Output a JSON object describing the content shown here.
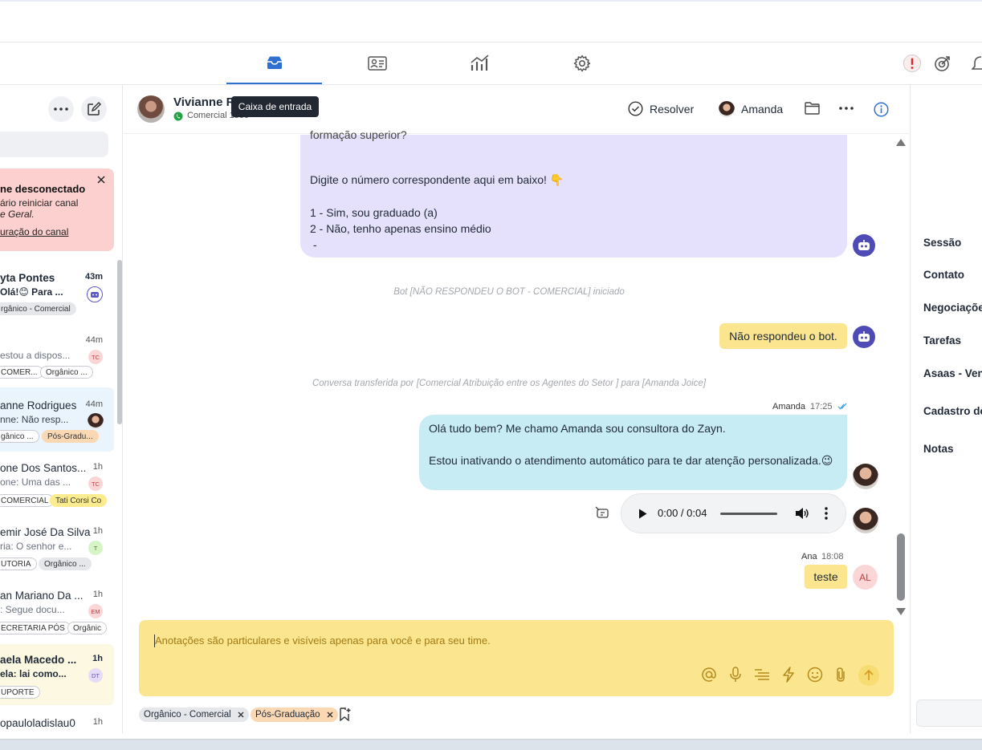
{
  "nav": {
    "tabs": [
      "inbox-icon",
      "contacts-icon",
      "reports-icon",
      "settings-icon"
    ],
    "tooltip": "Caixa de entrada"
  },
  "sidebar": {
    "alert": {
      "title": "ne desconectado",
      "line1": "ário reiniciar canal",
      "line2": "e Geral.",
      "link": "uração do canal"
    },
    "conversations": [
      {
        "name": "yta Pontes",
        "time": "43m",
        "preview": "Olá!😊 Para ...",
        "unread": true,
        "tags": [
          {
            "label": "rgânico - Comercial",
            "style": "grey"
          }
        ]
      },
      {
        "name": "",
        "time": "44m",
        "preview": "estou a dispos...",
        "avatar": "TC",
        "tags": [
          {
            "label": "COMER...",
            "style": "outline"
          },
          {
            "label": "Orgânico ...",
            "style": "outline"
          }
        ]
      },
      {
        "name": "anne Rodrigues",
        "time": "44m",
        "preview": "nne: Não resp...",
        "selected": true,
        "tags": [
          {
            "label": "gânico ...",
            "style": "outline"
          },
          {
            "label": "Pós-Gradu...",
            "style": "orange"
          }
        ]
      },
      {
        "name": "one Dos Santos...",
        "time": "1h",
        "preview": "one: Uma das ...",
        "avatar": "TC",
        "tags": [
          {
            "label": "COMERCIAL",
            "style": "outline"
          },
          {
            "label": "Tati Corsi Co",
            "style": "yellow"
          }
        ]
      },
      {
        "name": "emir José Da Silva",
        "time": "1h",
        "preview": "ria: O senhor e...",
        "avatar": "T",
        "tags": [
          {
            "label": "UTORIA",
            "style": "outline"
          },
          {
            "label": "Orgânico ...",
            "style": "grey"
          }
        ]
      },
      {
        "name": "an Mariano Da ...",
        "time": "1h",
        "preview": ": Segue docu...",
        "avatar": "EM",
        "tags": [
          {
            "label": "ECRETARIA PÓS",
            "style": "outline"
          },
          {
            "label": "Orgânic",
            "style": "outline"
          }
        ]
      },
      {
        "name": "aela Macedo ...",
        "time": "1h",
        "preview": "ela: lai como...",
        "avatar": "DT",
        "unread": true,
        "tags": [
          {
            "label": "UPORTE",
            "style": "outline"
          }
        ]
      },
      {
        "name": "opauloladislau0",
        "time": "1h",
        "preview": "",
        "tags": []
      }
    ]
  },
  "chat": {
    "contact_name": "Vivianne R",
    "contact_sub": "Comercial 1330",
    "resolve_label": "Resolver",
    "agent_name": "Amanda",
    "messages": {
      "bot_cut": "formação superior?",
      "bot_line1": "Digite o número correspondente aqui em baixo! 👇",
      "bot_line2": "1 - Sim, sou graduado (a)",
      "bot_line3": "2 - Não, tenho apenas ensino médio",
      "bot_line4": " -",
      "sys1": "Bot [NÃO RESPONDEU O BOT - COMERCIAL] iniciado",
      "bot_reply": "Não respondeu o bot.",
      "sys2": "Conversa transferida por [Comercial Atribuição entre os Agentes do Setor ] para [Amanda Joice]",
      "agent_sender": "Amanda",
      "agent_time": "17:25",
      "agent_line1": "Olá tudo bem? Me chamo Amanda sou consultora do Zayn.",
      "agent_line2": "Estou inativando o atendimento automático para te dar atenção personalizada.😉",
      "audio_time": "0:00 / 0:04",
      "ana_sender": "Ana",
      "ana_time": "18:08",
      "ana_text": "teste",
      "ana_avatar": "AL"
    },
    "composer_placeholder": "Anotações são particulares e visíveis apenas para você e para seu time.",
    "labels": [
      "Orgânico - Comercial",
      "Pós-Graduação"
    ]
  },
  "right_panel": {
    "items": [
      "Sessão",
      "Contato",
      "Negociaçõe",
      "Tarefas",
      "Asaas - Ven",
      "Cadastro de",
      "Notas"
    ]
  },
  "colors": {
    "accent": "#2f6fcf",
    "bot_bubble": "#e5e0fb",
    "agent_bubble": "#c7ecf3",
    "note_bubble": "#fbe68f",
    "composer": "#fbe68f",
    "alert_bg": "#fdd0d0"
  }
}
